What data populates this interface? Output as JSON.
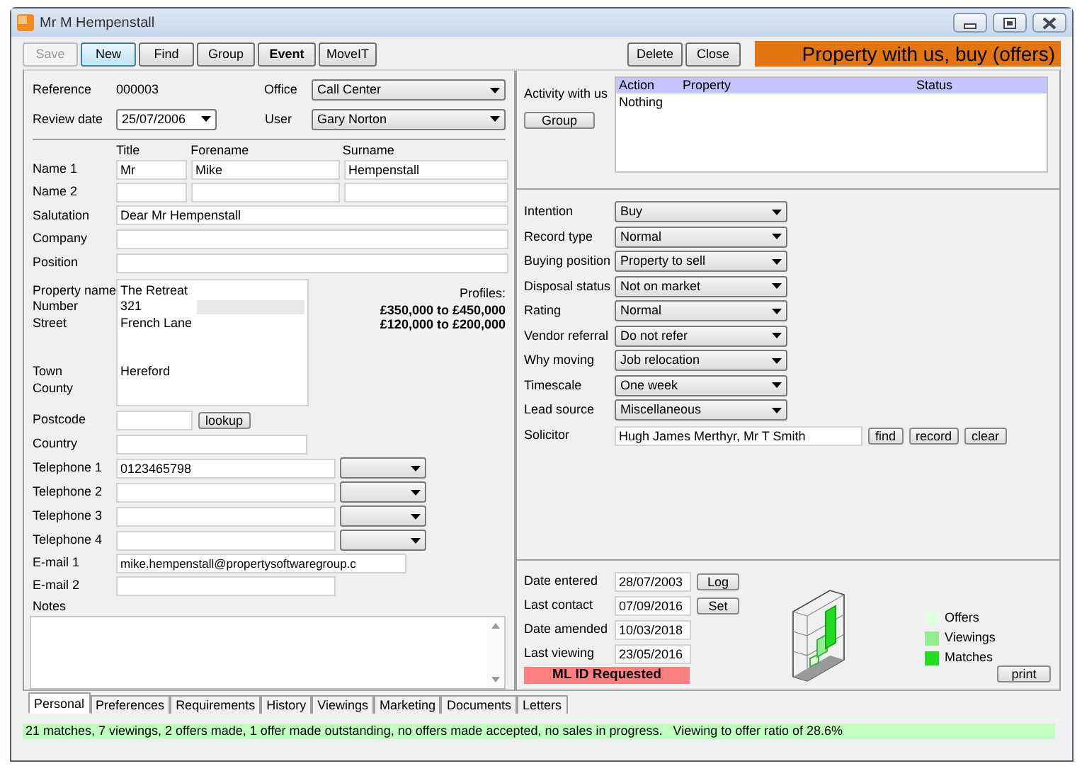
{
  "window": {
    "title": "Mr M Hempenstall"
  },
  "toolbar": [
    {
      "label": "Save",
      "disabled": true,
      "focused": false,
      "bold": false
    },
    {
      "label": "New",
      "disabled": false,
      "focused": true,
      "bold": false
    },
    {
      "label": "Find",
      "disabled": false,
      "focused": false,
      "bold": false
    },
    {
      "label": "Group",
      "disabled": false,
      "focused": false,
      "bold": false
    },
    {
      "label": "Event",
      "disabled": false,
      "focused": false,
      "bold": true
    },
    {
      "label": "MoveIT",
      "disabled": false,
      "focused": false,
      "bold": false
    }
  ],
  "actions": [
    "Delete",
    "Close"
  ],
  "banner": "Property with us, buy (offers)",
  "reference": {
    "label": "Reference",
    "value": "000003"
  },
  "review_date": {
    "label": "Review date",
    "value": "25/07/2006"
  },
  "office": {
    "label": "Office",
    "value": "Call Center"
  },
  "user": {
    "label": "User",
    "value": "Gary Norton"
  },
  "name_headers": [
    "Title",
    "Forename",
    "Surname"
  ],
  "names": [
    {
      "label": "Name 1",
      "values": [
        "Mr",
        "Mike",
        "Hempenstall"
      ]
    },
    {
      "label": "Name 2"
    }
  ],
  "text_fields": [
    {
      "label": "Salutation",
      "value": "Dear Mr Hempenstall"
    },
    {
      "label": "Company"
    },
    {
      "label": "Position"
    }
  ],
  "address": [
    {
      "kind": "line",
      "label": "Property name",
      "value": "The Retreat"
    },
    {
      "kind": "number",
      "label": "Number",
      "value": "321"
    },
    {
      "kind": "line",
      "label": "Street",
      "value": "French Lane"
    },
    {
      "kind": "gap"
    },
    {
      "kind": "gap"
    },
    {
      "kind": "line",
      "label": "Town",
      "value": "Hereford"
    },
    {
      "kind": "line",
      "label": "County"
    }
  ],
  "profiles": {
    "label": "Profiles:",
    "ranges": [
      "£350,000 to £450,000",
      "£120,000 to £200,000"
    ]
  },
  "postcode": {
    "label": "Postcode",
    "button": "lookup"
  },
  "country": {
    "label": "Country"
  },
  "telephones": [
    {
      "label": "Telephone 1",
      "value": "0123465798"
    },
    {
      "label": "Telephone 2"
    },
    {
      "label": "Telephone 3"
    },
    {
      "label": "Telephone 4"
    }
  ],
  "emails": [
    {
      "label": "E-mail 1",
      "value": "mike.hempenstall@propertysoftwaregroup.c"
    },
    {
      "label": "E-mail 2"
    }
  ],
  "notes": {
    "label": "Notes"
  },
  "activity": {
    "label": "Activity with us",
    "button": "Group",
    "columns": [
      "Action",
      "Property",
      "Status"
    ],
    "rows": [
      [
        "Nothing"
      ]
    ]
  },
  "combos": [
    {
      "label": "Intention",
      "value": "Buy"
    },
    {
      "label": "Record type",
      "value": "Normal"
    },
    {
      "label": "Buying position",
      "value": "Property to sell"
    },
    {
      "label": "Disposal status",
      "value": "Not on market"
    },
    {
      "label": "Rating",
      "value": "Normal"
    },
    {
      "label": "Vendor referral",
      "value": "Do not refer"
    },
    {
      "label": "Why moving",
      "value": "Job relocation"
    },
    {
      "label": "Timescale",
      "value": "One week"
    },
    {
      "label": "Lead source",
      "value": "Miscellaneous"
    }
  ],
  "solicitor": {
    "label": "Solicitor",
    "value": "Hugh James Merthyr, Mr T Smith",
    "buttons": [
      "find",
      "record",
      "clear"
    ]
  },
  "dates": [
    {
      "label": "Date entered",
      "value": "28/07/2003",
      "button": "Log"
    },
    {
      "label": "Last contact",
      "value": "07/09/2016",
      "button": "Set"
    },
    {
      "label": "Date amended",
      "value": "10/03/2018"
    },
    {
      "label": "Last viewing",
      "value": "23/05/2016"
    }
  ],
  "alert": "ML ID Requested",
  "legend": [
    {
      "label": "Offers",
      "color": "#e0ffe0"
    },
    {
      "label": "Viewings",
      "color": "#90ee90"
    },
    {
      "label": "Matches",
      "color": "#22dd22"
    }
  ],
  "print_button": "print",
  "tabs": [
    {
      "label": "Personal",
      "selected": true
    },
    {
      "label": "Preferences",
      "selected": false
    },
    {
      "label": "Requirements",
      "selected": false
    },
    {
      "label": "History",
      "selected": false
    },
    {
      "label": "Viewings",
      "selected": false
    },
    {
      "label": "Marketing",
      "selected": false
    },
    {
      "label": "Documents",
      "selected": false
    },
    {
      "label": "Letters",
      "selected": false
    }
  ],
  "status": "21 matches, 7 viewings, 2 offers made, 1 offer made outstanding, no offers made accepted, no sales in progress.   Viewing to offer ratio of 28.6%"
}
